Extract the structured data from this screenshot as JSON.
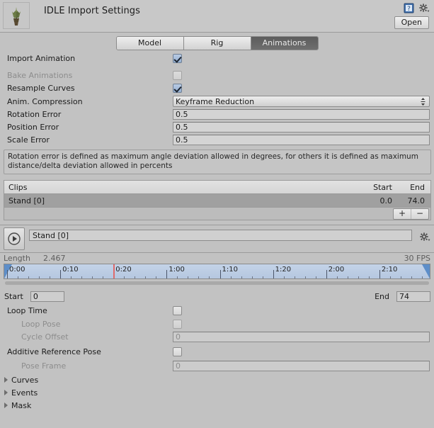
{
  "header": {
    "title": "IDLE Import Settings",
    "open_label": "Open",
    "help_icon": "help-book-icon",
    "gear_icon": "gear-dropdown-icon",
    "thumbnail_icon": "model-thumbnail-plant"
  },
  "tabs": [
    {
      "label": "Model",
      "active": false
    },
    {
      "label": "Rig",
      "active": false
    },
    {
      "label": "Animations",
      "active": true
    }
  ],
  "settings": {
    "import_animation": {
      "label": "Import Animation",
      "checked": true,
      "enabled": true
    },
    "bake_animations": {
      "label": "Bake Animations",
      "checked": false,
      "enabled": false
    },
    "resample_curves": {
      "label": "Resample Curves",
      "checked": true,
      "enabled": true
    },
    "anim_compression": {
      "label": "Anim. Compression",
      "value": "Keyframe Reduction"
    },
    "rotation_error": {
      "label": "Rotation Error",
      "value": "0.5"
    },
    "position_error": {
      "label": "Position Error",
      "value": "0.5"
    },
    "scale_error": {
      "label": "Scale Error",
      "value": "0.5"
    },
    "info_text": "Rotation error is defined as maximum angle deviation allowed in degrees, for others it is defined as maximum distance/delta deviation allowed in percents"
  },
  "clips": {
    "columns": {
      "name": "Clips",
      "start": "Start",
      "end": "End"
    },
    "rows": [
      {
        "name": "Stand [0]",
        "start": "0.0",
        "end": "74.0",
        "selected": true
      }
    ],
    "add_label": "+",
    "remove_label": "−"
  },
  "preview": {
    "play_icon": "play-icon",
    "clip_name": "Stand [0]",
    "gear_icon": "gear-dropdown-icon"
  },
  "timeline": {
    "length_label": "Length",
    "length_value": "2.467",
    "fps_label": "30 FPS",
    "ticks": [
      "0:00",
      "0:10",
      "0:20",
      "1:00",
      "1:10",
      "1:20",
      "2:00",
      "2:10"
    ],
    "playhead_label": "0:20",
    "start_label": "Start",
    "start_value": "0",
    "end_label": "End",
    "end_value": "74"
  },
  "loop": {
    "loop_time": {
      "label": "Loop Time",
      "checked": false,
      "enabled": true
    },
    "loop_pose": {
      "label": "Loop Pose",
      "checked": false,
      "enabled": false
    },
    "cycle_offset": {
      "label": "Cycle Offset",
      "value": "0",
      "enabled": false
    },
    "additive_reference_pose": {
      "label": "Additive Reference Pose",
      "checked": false,
      "enabled": true
    },
    "pose_frame": {
      "label": "Pose Frame",
      "value": "0",
      "enabled": false
    }
  },
  "foldouts": [
    {
      "label": "Curves"
    },
    {
      "label": "Events"
    },
    {
      "label": "Mask"
    }
  ],
  "colors": {
    "window_bg": "#c2c2c2",
    "header_bg": "#c8c8c8",
    "tab_active_bg": "#666666",
    "ruler_bg": "#bccde3",
    "handle_blue": "#5d8ec9",
    "playhead_red": "#e06a6a",
    "row_selected": "#a0a0a0"
  }
}
